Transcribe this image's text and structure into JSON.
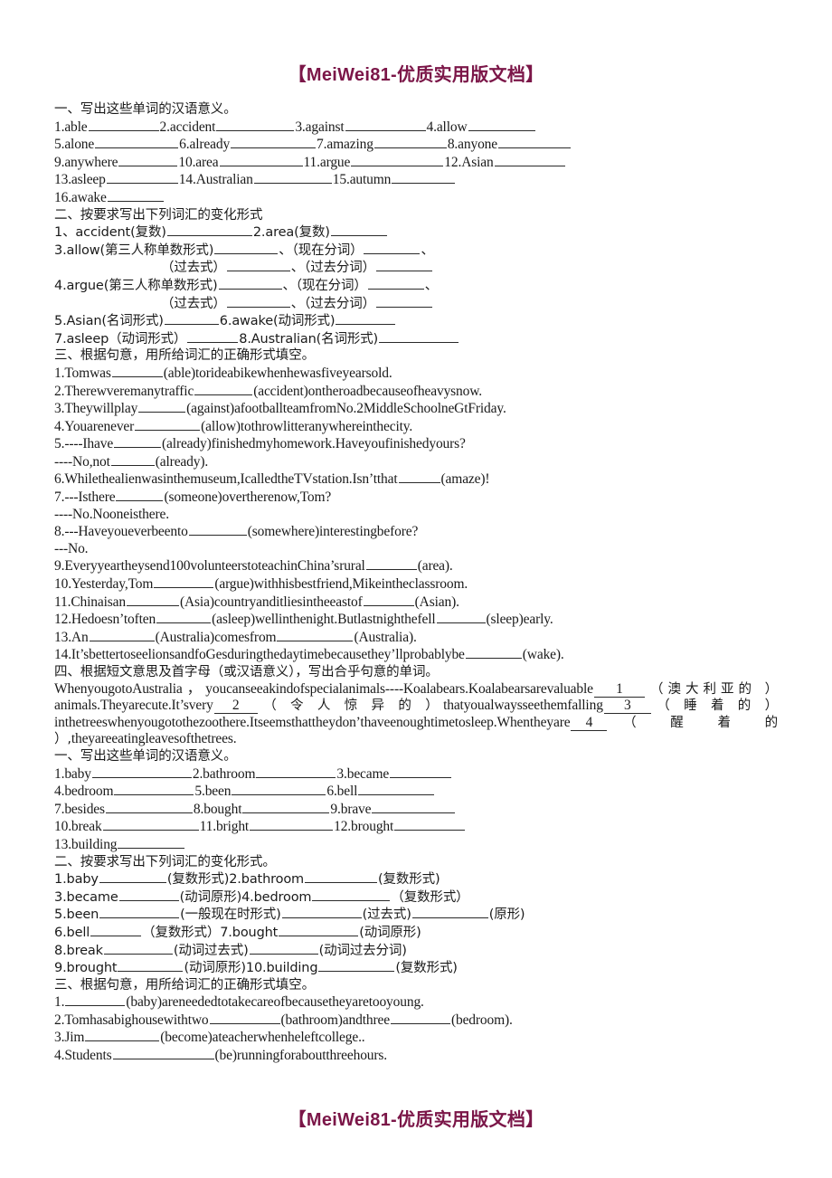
{
  "watermark": {
    "top": "【MeiWei81-优质实用版文档】",
    "bottom": "【MeiWei81-优质实用版文档】",
    "color": "#7b1648"
  },
  "part_one": {
    "section1_heading": "一、写出这些单词的汉语意义。",
    "words_line1": [
      "1.able",
      "2.accident",
      "3.against",
      "4.allow"
    ],
    "words_line2": [
      "5.alone",
      "6.already",
      "7.amazing",
      "8.anyone"
    ],
    "words_line3": [
      "9.anywhere",
      "10.area",
      "11.argue",
      "12.Asian"
    ],
    "words_line4": [
      "13.asleep",
      "14.Australian",
      "15.autumn"
    ],
    "words_line5": [
      "16.awake"
    ],
    "section2_heading": "二、按要求写出下列词汇的变化形式",
    "forms": {
      "line1_a": "1、accident(复数)",
      "line1_b": "2.area(复数)",
      "line2_a": "3.allow(第三人称单数形式)",
      "line2_b": "、（现在分词）",
      "line2_c": "、",
      "line3_a": "（过去式）",
      "line3_b": "、（过去分词）",
      "line4_a": "4.argue(第三人称单数形式)",
      "line4_b": "、（现在分词）",
      "line4_c": "、",
      "line5_a": "（过去式）",
      "line5_b": "、（过去分词）",
      "line6_a": "5.Asian(名词形式)",
      "line6_b": "6.awake(动词形式)",
      "line7_a": "7.asleep（动词形式）",
      "line7_b": "8.Australian(名词形式)"
    },
    "section3_heading": "三、根据句意，用所给词汇的正确形式填空。",
    "sentences": [
      {
        "pre": "1.Tomwas",
        "cue": "(able)",
        "post": "torideabikewhenhewasfiveyearsold."
      },
      {
        "pre": "2.Therewveremanytraffic",
        "cue": "(accident)",
        "post": "ontheroadbecauseofheavysnow."
      },
      {
        "pre": "3.Theywillplay",
        "cue": "(against)",
        "post": "afootballteamfromNo.2MiddleSchoolneGtFriday."
      },
      {
        "pre": "4.Youarenever",
        "cue": "(allow)",
        "post": "tothrowlitteranywhereinthecity."
      },
      {
        "pre": "5.----Ihave",
        "cue": "(already)",
        "post": "finishedmyhomework.Haveyoufinishedyours?"
      },
      {
        "pre": "----No,not",
        "cue": "(already).",
        "post": ""
      },
      {
        "pre": "6.Whilethealienwasinthemuseum,IcalledtheTVstation.Isn’tthat",
        "cue": "(amaze)!",
        "post": ""
      },
      {
        "pre": "7.---Isthere",
        "cue": "(someone)",
        "post": "overtherenow,Tom?"
      },
      {
        "pre": "----No.Nooneisthere.",
        "cue": "",
        "post": ""
      },
      {
        "pre": "8.---Haveyoueverbeento",
        "cue": "(somewhere)",
        "post": "interestingbefore?"
      },
      {
        "pre": "---No.",
        "cue": "",
        "post": ""
      },
      {
        "pre": "9.Everyyeartheysend100volunteerstoteachinChina’srural",
        "cue": "(area).",
        "post": ""
      },
      {
        "pre": "10.Yesterday,Tom",
        "cue": "(argue)",
        "post": "withhisbestfriend,Mikeintheclassroom."
      },
      {
        "pre": "11.Chinaisan",
        "cue": "(Asia)",
        "post": "countryanditliesintheeastof"
      },
      {
        "pre": "12.Hedoesn’toften",
        "cue": "(asleep)",
        "post": "wellinthenight.Butlastnighthefell"
      },
      {
        "pre": "13.An",
        "cue": "(Australia)",
        "post": "comesfrom"
      },
      {
        "pre": "14.It’sbettertoseelionsandfoGesduringthedaytimebecausethey’llprobablybe",
        "cue": "(wake).",
        "post": ""
      }
    ],
    "sentence11_tail": "(Asian).",
    "sentence12_tail": "(sleep)early.",
    "sentence13_tail": "(Australia).",
    "section4_heading": "四、根据短文意思及首字母（或汉语意义），写出合乎句意的单词。",
    "passage": {
      "seg1": "WhenyougotoAustralia，youcanseeakindofspecialanimals----Koalabears.Koalabearsarevaluable",
      "blank1": "1",
      "hint1": "（澳大利亚的 ）",
      "seg2": "animals.Theyarecute.It’svery",
      "blank2": "2",
      "hint2": "（ 令 人 惊 异 的 ）",
      "seg3": "thatyoualwaysseethemfalling",
      "blank3": "3",
      "hint3": "（ 睡 着 的 ）",
      "seg4": "inthetreeswhenyougotothezoothere.Itseemsthattheydon’thaveenoughtimetosleep.Whentheyare",
      "blank4": "4",
      "hint4": "（ 醒 着 的 ）,",
      "seg5": "theyareeatingleavesofthetrees."
    }
  },
  "part_two": {
    "section1_heading": "一、写出这些单词的汉语意义。",
    "words_line1": [
      "1.baby",
      "2.bathroom",
      "3.became"
    ],
    "words_line2": [
      "4.bedroom",
      "5.been",
      "6.bell"
    ],
    "words_line3": [
      "7.besides",
      "8.bought",
      "9.brave"
    ],
    "words_line4": [
      "10.break",
      "11.bright",
      "12.brought"
    ],
    "words_line5": [
      "13.building"
    ],
    "section2_heading": "二、按要求写出下列词汇的变化形式。",
    "forms": {
      "line1_a": "1.baby",
      "line1_b": "(复数形式)2.bathroom",
      "line1_c": "(复数形式)",
      "line2_a": "3.became",
      "line2_b": "(动词原形)4.bedroom",
      "line2_c": "（复数形式）",
      "line3_a": "5.been",
      "line3_b": "(一般现在时形式)",
      "line3_c": "(过去式)",
      "line3_d": "(原形)",
      "line4_a": "6.bell",
      "line4_b": "（复数形式）7.bought",
      "line4_c": "(动词原形)",
      "line5_a": "8.break",
      "line5_b": "(动词过去式)",
      "line5_c": "(动词过去分词)",
      "line6_a": "9.brought",
      "line6_b": "(动词原形)10.building",
      "line6_c": "(复数形式)"
    },
    "section3_heading": "三、根据句意，用所给词汇的正确形式填空。",
    "sentences": [
      {
        "pre": "1.",
        "cue": "(baby)",
        "post": "areneededtotakecareofbecausetheyaretooyoung."
      },
      {
        "pre": "2.Tomhasabighousewithtwo",
        "cue": "(bathroom)",
        "post": "andthree"
      },
      {
        "pre": "3.Jim",
        "cue": "(become)",
        "post": "ateacherwhenheleftcollege.."
      },
      {
        "pre": "4.Students",
        "cue": "(be)",
        "post": "runningforaboutthreehours."
      }
    ],
    "sentence2_tail": "(bedroom)."
  }
}
